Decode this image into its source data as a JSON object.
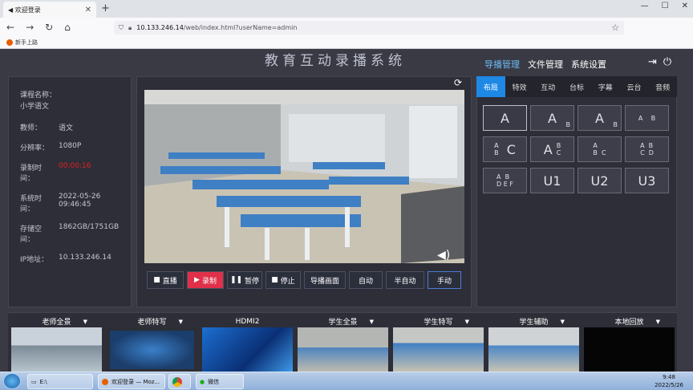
{
  "browser": {
    "tab_title": "欢迎登录",
    "new_tab": "+",
    "url_host": "10.133.246.14",
    "url_path": "/web/index.html?userName=admin",
    "bookmark": "新手上路"
  },
  "app": {
    "title": "教育互动录播系统",
    "nav": [
      "导播管理",
      "文件管理",
      "系统设置"
    ]
  },
  "info": {
    "course_label": "课程名称：",
    "course_value": "小学语文",
    "teacher_label": "教师：",
    "teacher_value": "语文",
    "resolution_label": "分辨率：",
    "resolution_value": "1080P",
    "rectime_label": "录制时间：",
    "rectime_value": "00:00:16",
    "systime_label": "系统时间：",
    "systime_value": "2022-05-26 09:46:45",
    "storage_label": "存储空间：",
    "storage_value": "1862GB/1751GB",
    "ip_label": "IP地址：",
    "ip_value": "10.133.246.14"
  },
  "controls": {
    "live": "直播",
    "record": "录制",
    "pause": "暂停",
    "stop": "停止",
    "director": "导播画面",
    "auto": "自动",
    "semi": "半自动",
    "manual": "手动"
  },
  "right_tabs": [
    "布局",
    "特效",
    "互动",
    "台标",
    "字幕",
    "云台",
    "音频"
  ],
  "cameras": [
    "老师全景",
    "老师特写",
    "HDMI2",
    "学生全景",
    "学生特写",
    "学生辅助",
    "本地回放"
  ],
  "taskbar": {
    "drive": "E:\\",
    "firefox_task": "欢迎登录 — Moz...",
    "wechat": "微信",
    "time": "9:48",
    "date": "2022/5/26"
  },
  "colors": {
    "accent": "#1e88e5",
    "record": "#e0304a",
    "rectime": "#e02020"
  }
}
